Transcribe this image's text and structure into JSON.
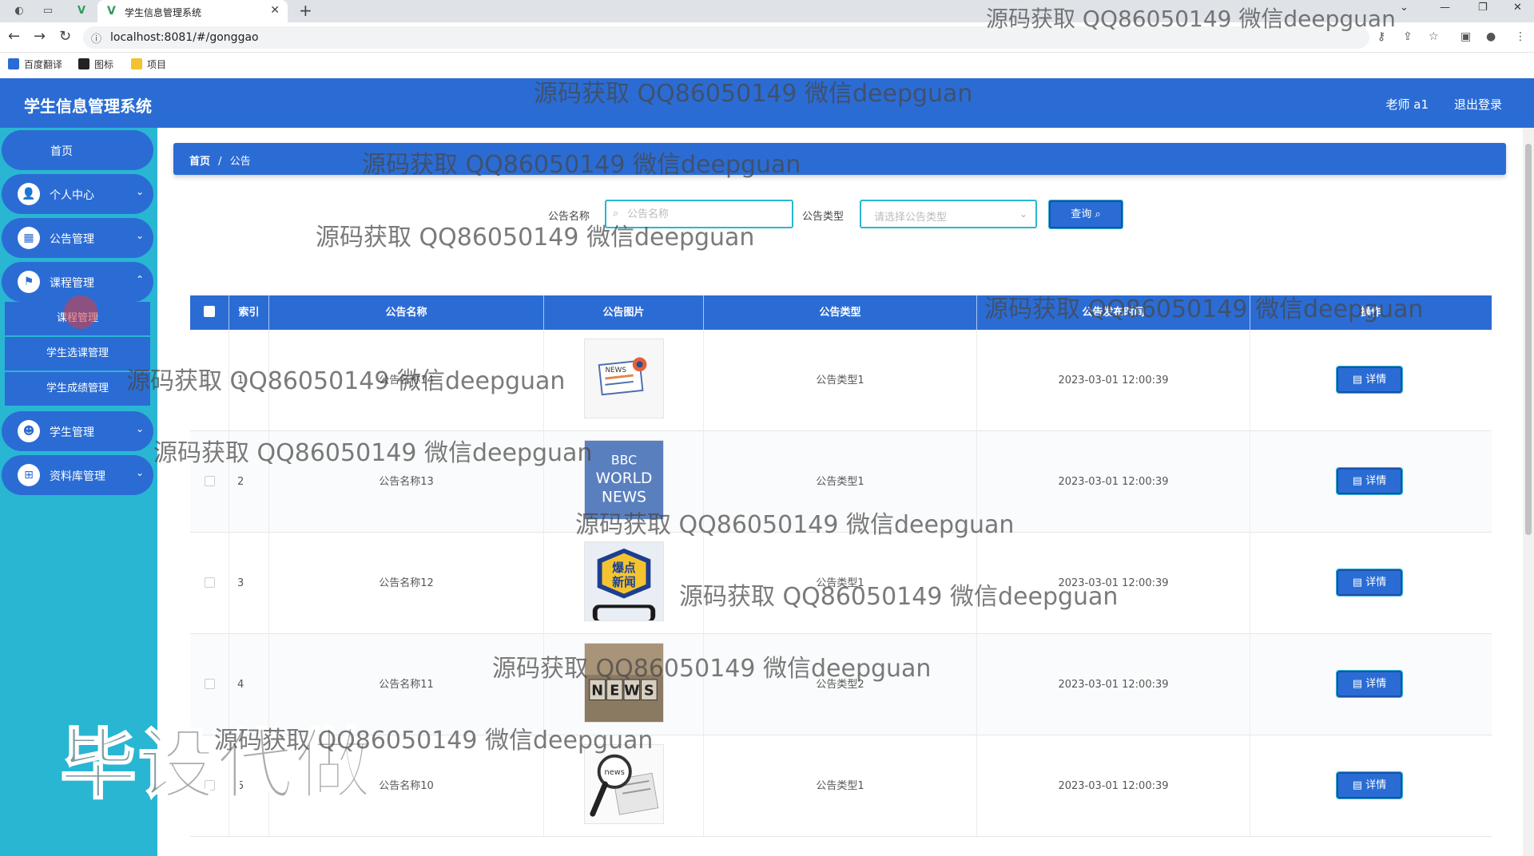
{
  "browser": {
    "tab_title": "学生信息管理系统",
    "url": "localhost:8081/#/gonggao",
    "bookmarks": [
      "百度翻译",
      "图标",
      "项目"
    ]
  },
  "header": {
    "app_title": "学生信息管理系统",
    "user": "老师 a1",
    "logout": "退出登录"
  },
  "sidebar": {
    "home": "首页",
    "items": [
      {
        "label": "个人中心",
        "icon": "user-icon"
      },
      {
        "label": "公告管理",
        "icon": "grid-icon"
      },
      {
        "label": "课程管理",
        "icon": "flag-icon"
      },
      {
        "label": "学生管理",
        "icon": "student-icon"
      },
      {
        "label": "资料库管理",
        "icon": "apps-icon"
      }
    ],
    "submenu": [
      "课程管理",
      "学生选课管理",
      "学生成绩管理"
    ]
  },
  "breadcrumb": {
    "home": "首页",
    "sep": "/",
    "current": "公告"
  },
  "search": {
    "name_label": "公告名称",
    "name_placeholder": "公告名称",
    "type_label": "公告类型",
    "type_placeholder": "请选择公告类型",
    "query_button": "查询"
  },
  "table": {
    "columns": [
      "索引",
      "公告名称",
      "公告图片",
      "公告类型",
      "公告发布时间",
      "操作"
    ],
    "rows": [
      {
        "index": "1",
        "name": "公告名称14",
        "type": "公告类型1",
        "time": "2023-03-01 12:00:39",
        "action": "详情",
        "image": "news-flyer"
      },
      {
        "index": "2",
        "name": "公告名称13",
        "type": "公告类型1",
        "time": "2023-03-01 12:00:39",
        "action": "详情",
        "image": "bbc-world-news"
      },
      {
        "index": "3",
        "name": "公告名称12",
        "type": "公告类型1",
        "time": "2023-03-01 12:00:39",
        "action": "详情",
        "image": "breaking-news-phone"
      },
      {
        "index": "4",
        "name": "公告名称11",
        "type": "公告类型2",
        "time": "2023-03-01 12:00:39",
        "action": "详情",
        "image": "news-blocks"
      },
      {
        "index": "5",
        "name": "公告名称10",
        "type": "公告类型1",
        "time": "2023-03-01 12:00:39",
        "action": "详情",
        "image": "news-magnifier"
      }
    ]
  },
  "thumbs": {
    "bbc": [
      "BBC",
      "WORLD",
      "NEWS"
    ],
    "breaking": [
      "爆点",
      "新闻"
    ],
    "news_letters": [
      "N",
      "E",
      "W",
      "S"
    ],
    "news_small": "NEWS",
    "news_lower": "news"
  },
  "watermarks": {
    "text": "源码获取 QQ86050149 微信deepguan",
    "big": "毕设代做"
  },
  "colors": {
    "primary": "#2b6cd4",
    "sidebar": "#29b6d3"
  }
}
